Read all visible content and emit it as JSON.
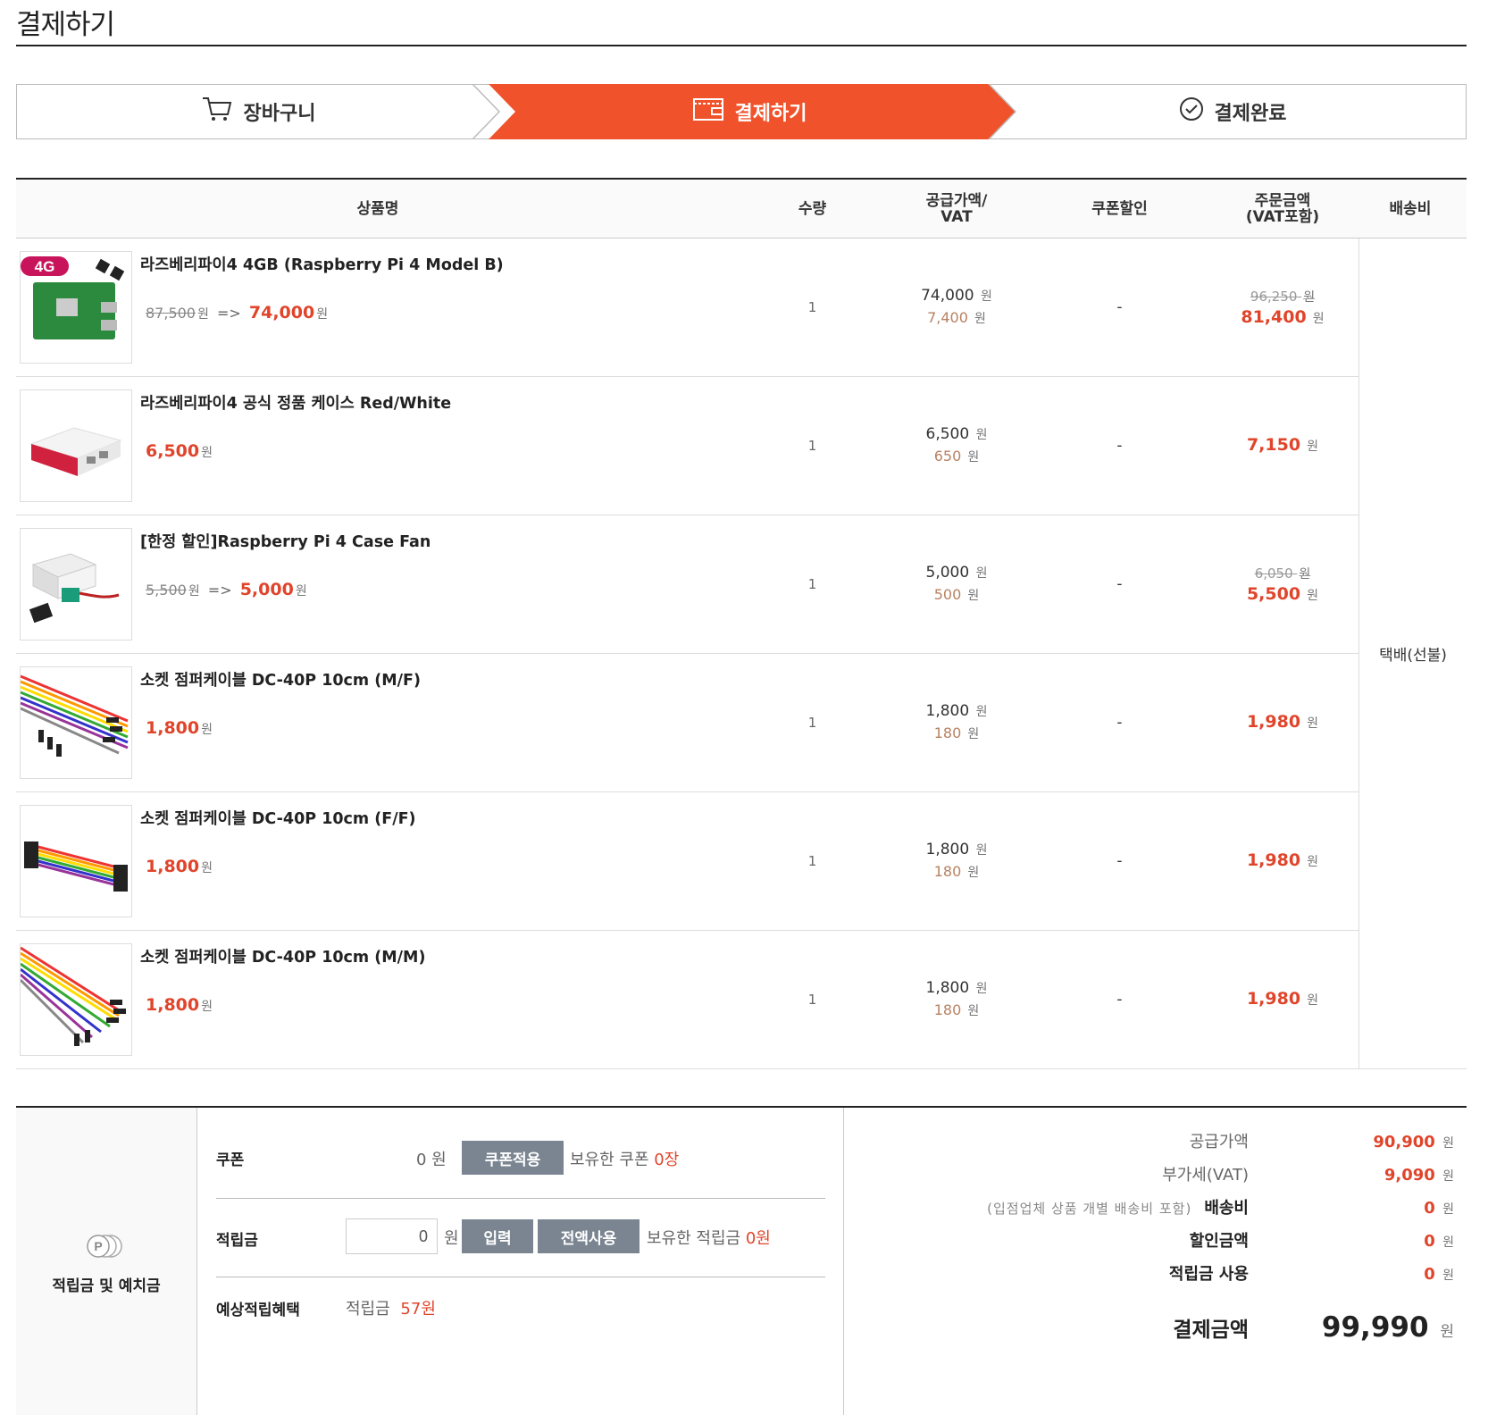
{
  "page": {
    "title": "결제하기"
  },
  "steps": [
    {
      "label": "장바구니"
    },
    {
      "label": "결제하기"
    },
    {
      "label": "결제완료"
    }
  ],
  "table": {
    "headers": {
      "name": "상품명",
      "qty": "수량",
      "supply_line1": "공급가액/",
      "supply_line2": "VAT",
      "coupon": "쿠폰할인",
      "total_line1": "주문금액",
      "total_line2": "(VAT포함)",
      "shipping": "배송비"
    },
    "shipping_value": "택배(선불)",
    "won": "원",
    "arrow": "=>",
    "rows": [
      {
        "name": "라즈베리파이4 4GB (Raspberry Pi 4 Model B)",
        "old_price": "87,500",
        "price": "74,000",
        "qty": "1",
        "supply": "74,000",
        "vat": "7,400",
        "coupon": "-",
        "total_old": "96,250",
        "total": "81,400",
        "thumb_badge": "4G"
      },
      {
        "name": "라즈베리파이4 공식 정품 케이스 Red/White",
        "old_price": "",
        "price": "6,500",
        "qty": "1",
        "supply": "6,500",
        "vat": "650",
        "coupon": "-",
        "total_old": "",
        "total": "7,150"
      },
      {
        "name": "[한정 할인]Raspberry Pi 4 Case Fan",
        "old_price": "5,500",
        "price": "5,000",
        "qty": "1",
        "supply": "5,000",
        "vat": "500",
        "coupon": "-",
        "total_old": "6,050",
        "total": "5,500"
      },
      {
        "name": "소켓 점퍼케이블 DC-40P 10cm (M/F)",
        "old_price": "",
        "price": "1,800",
        "qty": "1",
        "supply": "1,800",
        "vat": "180",
        "coupon": "-",
        "total_old": "",
        "total": "1,980"
      },
      {
        "name": "소켓 점퍼케이블 DC-40P 10cm (F/F)",
        "old_price": "",
        "price": "1,800",
        "qty": "1",
        "supply": "1,800",
        "vat": "180",
        "coupon": "-",
        "total_old": "",
        "total": "1,980"
      },
      {
        "name": "소켓 점퍼케이블 DC-40P 10cm (M/M)",
        "old_price": "",
        "price": "1,800",
        "qty": "1",
        "supply": "1,800",
        "vat": "180",
        "coupon": "-",
        "total_old": "",
        "total": "1,980"
      }
    ]
  },
  "points": {
    "side_label": "적립금 및 예치금",
    "icon_text": "P",
    "coupon_label": "쿠폰",
    "coupon_amount": "0 원",
    "coupon_button": "쿠폰적용",
    "coupon_owned_prefix": "보유한 쿠폰",
    "coupon_owned_count": "0장",
    "reward_label": "적립금",
    "reward_input_value": "0",
    "reward_won": "원",
    "input_button": "입력",
    "use_all_button": "전액사용",
    "reward_owned_prefix": "보유한 적립금",
    "reward_owned_amount": "0원",
    "expected_label": "예상적립혜택",
    "expected_prefix": "적립금",
    "expected_amount": "57원"
  },
  "totals": {
    "supply_label": "공급가액",
    "supply_value": "90,900",
    "vat_label": "부가세(VAT)",
    "vat_value": "9,090",
    "shipping_note": "(입점업체 상품 개별 배송비 포함)",
    "shipping_label": "배송비",
    "shipping_value": "0",
    "discount_label": "할인금액",
    "discount_value": "0",
    "reward_use_label": "적립금 사용",
    "reward_use_value": "0",
    "grand_label": "결제금액",
    "grand_value": "99,990",
    "won": "원"
  },
  "colors": {
    "accent": "#f0532b",
    "price_red": "#e0452b",
    "vat_brown": "#b88262",
    "button_gray": "#7a8591"
  }
}
